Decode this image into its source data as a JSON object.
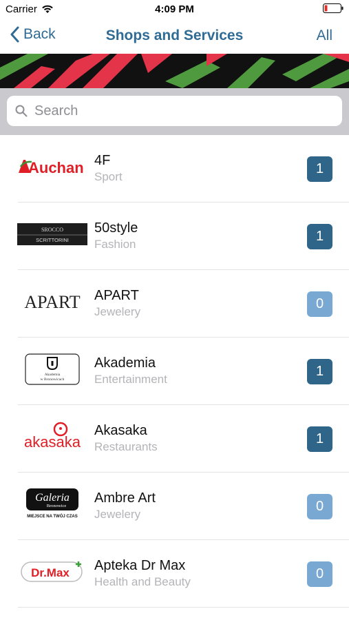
{
  "status_bar": {
    "carrier": "Carrier",
    "time": "4:09 PM"
  },
  "nav": {
    "back_label": "Back",
    "title": "Shops and Services",
    "right_label": "All"
  },
  "search": {
    "placeholder": "Search"
  },
  "colors": {
    "accent": "#2f6b95",
    "badge_dark": "#2e6588",
    "badge_light": "#79a9d3"
  },
  "shops": [
    {
      "name": "4F",
      "category": "Sport",
      "count": "1",
      "logo": "Auchan",
      "logo_kind": "auchan-logo"
    },
    {
      "name": "50style",
      "category": "Fashion",
      "count": "1",
      "logo_top": "SROCCO",
      "logo_bottom": "SCRITTORINI",
      "logo_kind": "scrittorini-logo"
    },
    {
      "name": "APART",
      "category": "Jewelery",
      "count": "0",
      "logo": "APART",
      "logo_kind": "apart-logo"
    },
    {
      "name": "Akademia",
      "category": "Entertainment",
      "count": "1",
      "logo_top": "Akademia",
      "logo_bottom": "w Bronowicach",
      "logo_kind": "akademia-logo"
    },
    {
      "name": "Akasaka",
      "category": "Restaurants",
      "count": "1",
      "logo": "akasaka",
      "logo_kind": "akasaka-logo"
    },
    {
      "name": "Ambre Art",
      "category": "Jewelery",
      "count": "0",
      "logo_top": "Galeria",
      "logo_sub": "Bronowice",
      "logo_bottom": "MIEJSCE NA TWÓJ CZAS",
      "logo_kind": "galeria-logo"
    },
    {
      "name": "Apteka Dr Max",
      "category": "Health and Beauty",
      "count": "0",
      "logo": "Dr.Max",
      "logo_kind": "drmax-logo"
    }
  ]
}
